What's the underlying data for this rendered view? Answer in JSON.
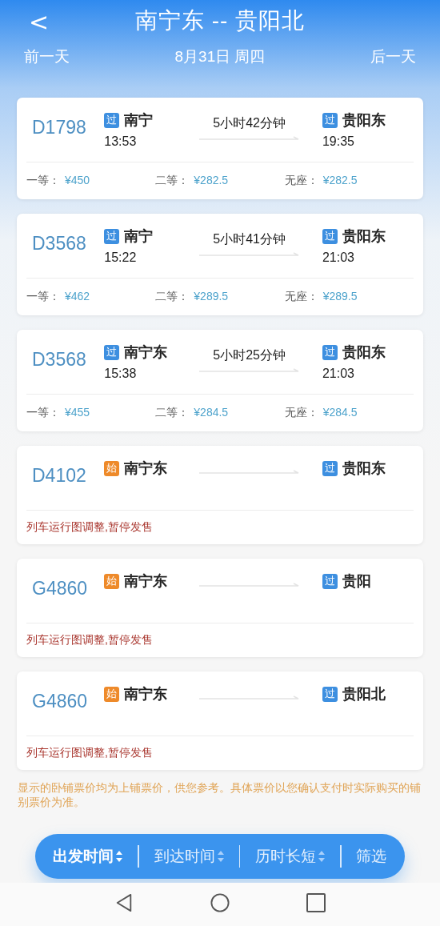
{
  "header": {
    "back": "<",
    "title": "南宁东 -- 贵阳北",
    "prev_day": "前一天",
    "date": "8月31日 周四",
    "next_day": "后一天"
  },
  "trains": [
    {
      "number": "D1798",
      "from": {
        "badge": "过",
        "kind": "pass",
        "name": "南宁",
        "time": "13:53"
      },
      "duration": "5小时42分钟",
      "to": {
        "badge": "过",
        "kind": "pass",
        "name": "贵阳东",
        "time": "19:35"
      },
      "prices": [
        {
          "label": "一等：",
          "price": "¥450"
        },
        {
          "label": "二等：",
          "price": "¥282.5"
        },
        {
          "label": "无座：",
          "price": "¥282.5"
        }
      ]
    },
    {
      "number": "D3568",
      "from": {
        "badge": "过",
        "kind": "pass",
        "name": "南宁",
        "time": "15:22"
      },
      "duration": "5小时41分钟",
      "to": {
        "badge": "过",
        "kind": "pass",
        "name": "贵阳东",
        "time": "21:03"
      },
      "prices": [
        {
          "label": "一等：",
          "price": "¥462"
        },
        {
          "label": "二等：",
          "price": "¥289.5"
        },
        {
          "label": "无座：",
          "price": "¥289.5"
        }
      ]
    },
    {
      "number": "D3568",
      "from": {
        "badge": "过",
        "kind": "pass",
        "name": "南宁东",
        "time": "15:38"
      },
      "duration": "5小时25分钟",
      "to": {
        "badge": "过",
        "kind": "pass",
        "name": "贵阳东",
        "time": "21:03"
      },
      "prices": [
        {
          "label": "一等：",
          "price": "¥455"
        },
        {
          "label": "二等：",
          "price": "¥284.5"
        },
        {
          "label": "无座：",
          "price": "¥284.5"
        }
      ]
    },
    {
      "number": "D4102",
      "from": {
        "badge": "始",
        "kind": "origin",
        "name": "南宁东"
      },
      "to": {
        "badge": "过",
        "kind": "pass",
        "name": "贵阳东"
      },
      "notice": "列车运行图调整,暂停发售"
    },
    {
      "number": "G4860",
      "from": {
        "badge": "始",
        "kind": "origin",
        "name": "南宁东"
      },
      "to": {
        "badge": "过",
        "kind": "pass",
        "name": "贵阳"
      },
      "notice": "列车运行图调整,暂停发售"
    },
    {
      "number": "G4860",
      "from": {
        "badge": "始",
        "kind": "origin",
        "name": "南宁东"
      },
      "to": {
        "badge": "过",
        "kind": "pass",
        "name": "贵阳北"
      },
      "notice": "列车运行图调整,暂停发售"
    }
  ],
  "footnote": "显示的卧铺票价均为上铺票价，供您参考。具体票价以您确认支付时实际购买的铺别票价为准。",
  "sort_bar": [
    {
      "label": "出发时间",
      "kind": "sort",
      "selected": true
    },
    {
      "label": "到达时间",
      "kind": "sort",
      "selected": false
    },
    {
      "label": "历时长短",
      "kind": "sort",
      "selected": false
    },
    {
      "label": "筛选",
      "kind": "filter",
      "selected": false
    }
  ]
}
